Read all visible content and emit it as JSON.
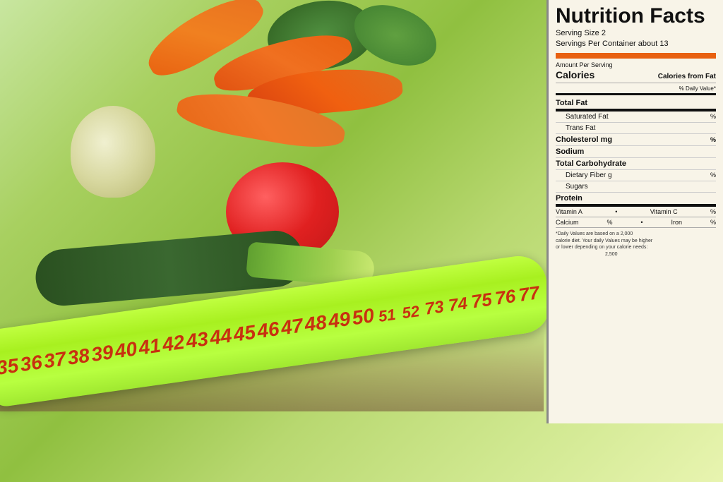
{
  "background": {
    "alt": "Fresh vegetables with measuring tape"
  },
  "nutrition": {
    "title": "Nutrition Facts",
    "serving_size_label": "Serving Size",
    "serving_size_value": "2",
    "servings_per_label": "Servings  Per Container",
    "servings_per_value": "about 13",
    "amount_per_serving": "Amount Per Serving",
    "calories_label": "Calories",
    "calories_from_fat_label": "Calories from Fat",
    "daily_value_header": "% Daily Value*",
    "rows": [
      {
        "label": "Total Fat",
        "value": "",
        "percent": "",
        "bold": true,
        "indent": false
      },
      {
        "label": "Saturated Fat",
        "value": "",
        "percent": "%",
        "bold": false,
        "indent": true
      },
      {
        "label": "Trans  Fat",
        "value": "",
        "percent": "",
        "bold": false,
        "indent": true
      },
      {
        "label": "Cholesterol",
        "value": "mg",
        "percent": "%",
        "bold": true,
        "indent": false
      },
      {
        "label": "Sodium",
        "value": "",
        "percent": "",
        "bold": true,
        "indent": false
      },
      {
        "label": "Total Carbohydrate",
        "value": "",
        "percent": "",
        "bold": true,
        "indent": false
      },
      {
        "label": "Dietary Fiber",
        "value": "g",
        "percent": "%",
        "bold": false,
        "indent": true
      },
      {
        "label": "Sugars",
        "value": "",
        "percent": "",
        "bold": false,
        "indent": true
      },
      {
        "label": "Protein",
        "value": "",
        "percent": "",
        "bold": true,
        "indent": false
      }
    ],
    "vitamins": [
      {
        "label": "Vitamin A",
        "bullet": "•",
        "label2": "Vitamin C",
        "value2": "%"
      },
      {
        "label": "Calcium",
        "value": "%",
        "bullet": "•",
        "label2": "Iron",
        "value2": "%"
      }
    ],
    "footnote_lines": [
      "*Daily Values are based on a 2,000",
      "calorie diet. Your daily Values may be higher",
      "or lower depending on your calorie needs:",
      "2,500"
    ]
  },
  "tape": {
    "numbers": [
      "35",
      "36",
      "37",
      "38",
      "39",
      "40",
      "41",
      "42",
      "43",
      "44",
      "45",
      "46",
      "47",
      "48",
      "49",
      "50",
      "51",
      "52",
      "73",
      "74",
      "75",
      "76",
      "77"
    ]
  }
}
